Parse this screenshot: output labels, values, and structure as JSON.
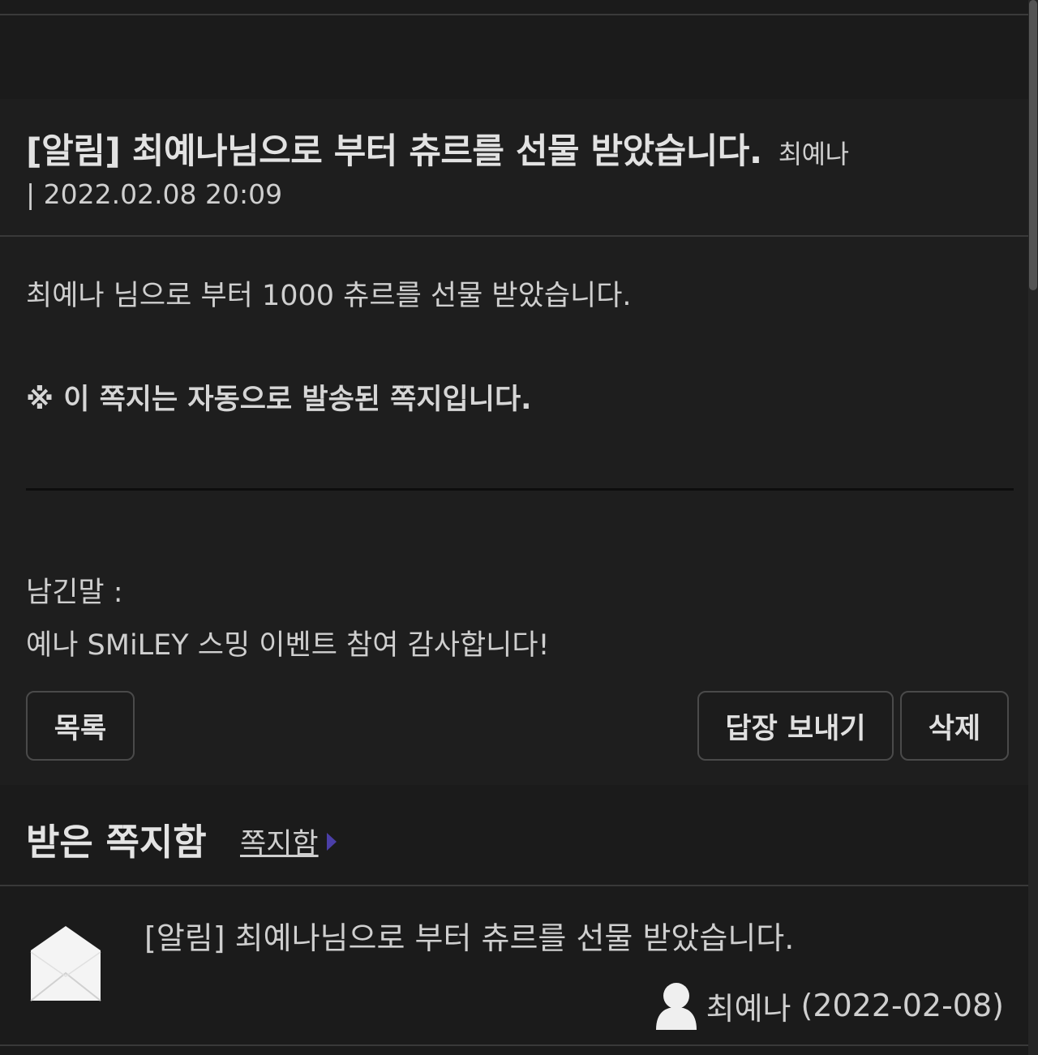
{
  "message": {
    "title": "[알림] 최예나님으로 부터 츄르를 선물 받았습니다.",
    "sender": "최예나",
    "date": "| 2022.02.08 20:09",
    "body_line1": "최예나 님으로 부터 1000 츄르를 선물 받았습니다.",
    "body_note": "※ 이 쪽지는 자동으로 발송된 쪽지입니다.",
    "memo_label": "남긴말 :",
    "memo_text": "예나 SMiLEY 스밍 이벤트 참여 감사합니다!"
  },
  "buttons": {
    "list_label": "목록",
    "reply_label": "답장 보내기",
    "delete_label": "삭제"
  },
  "inbox": {
    "title": "받은 쪽지함",
    "link_label": "쪽지함",
    "items": [
      {
        "icon": "envelope-icon",
        "title": "[알림] 최예나님으로 부터 츄르를 선물 받았습니다.",
        "sender": "최예나",
        "date": "(2022-02-08)"
      }
    ]
  },
  "colors": {
    "background": "#1e1e1e",
    "text": "#cfcfcf",
    "arrow_accent": "#4b3fa8"
  }
}
